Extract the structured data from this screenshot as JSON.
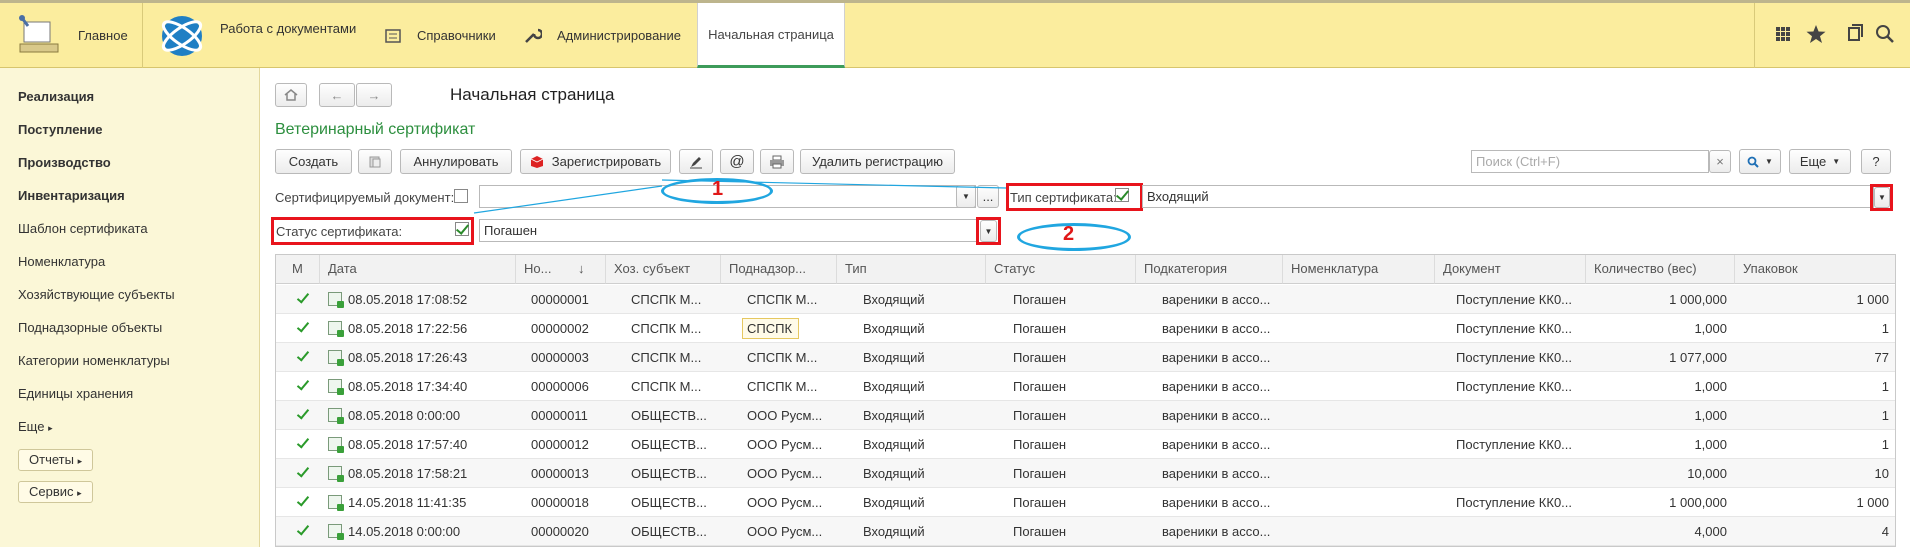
{
  "topbar": {
    "home": "Главное",
    "docs": "Работа с документами",
    "refs": "Справочники",
    "admin": "Администрирование",
    "start": "Начальная страница"
  },
  "sidebar": {
    "items": [
      "Реализация",
      "Поступление",
      "Производство",
      "Инвентаризация",
      "Шаблон сертификата",
      "Номенклатура",
      "Хозяйствующие субъекты",
      "Поднадзорные объекты",
      "Категории номенклатуры",
      "Единицы хранения",
      "Еще"
    ],
    "reports": "Отчеты",
    "service": "Сервис"
  },
  "main": {
    "page_title": "Начальная страница",
    "form_title": "Ветеринарный сертификат",
    "toolbar": {
      "create": "Создать",
      "cancel": "Аннулировать",
      "register": "Зарегистрировать",
      "unregister": "Удалить регистрацию",
      "search_placeholder": "Поиск (Ctrl+F)",
      "more": "Еще",
      "help": "?"
    },
    "filters": {
      "cert_doc_label": "Сертифицируемый документ:",
      "cert_type_label": "Тип сертификата:",
      "cert_type_value": "Входящий",
      "status_label": "Статус сертификата:",
      "status_value": "Погашен"
    },
    "annotations": [
      "1",
      "2"
    ]
  },
  "table": {
    "columns": [
      "М",
      "Дата",
      "Но...",
      "Хоз. субъект",
      "Поднадзор...",
      "Тип",
      "Статус",
      "Подкатегория",
      "Номенклатура",
      "Документ",
      "Количество (вес)",
      "Упаковок"
    ],
    "rows": [
      {
        "date": "08.05.2018 17:08:52",
        "num": "00000001",
        "subject": "СПСПК  М...",
        "object": "СПСПК  М...",
        "type": "Входящий",
        "status": "Погашен",
        "subcat": "вареники в ассо...",
        "nomen": "",
        "doc": "Поступление КК0...",
        "qty": "1 000,000",
        "pack": "1 000"
      },
      {
        "date": "08.05.2018 17:22:56",
        "num": "00000002",
        "subject": "СПСПК  М...",
        "object": "СПСПК",
        "type": "Входящий",
        "status": "Погашен",
        "subcat": "вареники в ассо...",
        "nomen": "",
        "doc": "Поступление КК0...",
        "qty": "1,000",
        "pack": "1"
      },
      {
        "date": "08.05.2018 17:26:43",
        "num": "00000003",
        "subject": "СПСПК  М...",
        "object": "СПСПК  М...",
        "type": "Входящий",
        "status": "Погашен",
        "subcat": "вареники в ассо...",
        "nomen": "",
        "doc": "Поступление КК0...",
        "qty": "1 077,000",
        "pack": "77"
      },
      {
        "date": "08.05.2018 17:34:40",
        "num": "00000006",
        "subject": "СПСПК  М...",
        "object": "СПСПК  М...",
        "type": "Входящий",
        "status": "Погашен",
        "subcat": "вареники в ассо...",
        "nomen": "",
        "doc": "Поступление КК0...",
        "qty": "1,000",
        "pack": "1"
      },
      {
        "date": "08.05.2018 0:00:00",
        "num": "00000011",
        "subject": "ОБЩЕСТВ...",
        "object": "ООО Русм...",
        "type": "Входящий",
        "status": "Погашен",
        "subcat": "вареники в ассо...",
        "nomen": "",
        "doc": "",
        "qty": "1,000",
        "pack": "1"
      },
      {
        "date": "08.05.2018 17:57:40",
        "num": "00000012",
        "subject": "ОБЩЕСТВ...",
        "object": "ООО Русм...",
        "type": "Входящий",
        "status": "Погашен",
        "subcat": "вареники в ассо...",
        "nomen": "",
        "doc": "Поступление КК0...",
        "qty": "1,000",
        "pack": "1"
      },
      {
        "date": "08.05.2018 17:58:21",
        "num": "00000013",
        "subject": "ОБЩЕСТВ...",
        "object": "ООО Русм...",
        "type": "Входящий",
        "status": "Погашен",
        "subcat": "вареники в ассо...",
        "nomen": "",
        "doc": "",
        "qty": "10,000",
        "pack": "10"
      },
      {
        "date": "14.05.2018 11:41:35",
        "num": "00000018",
        "subject": "ОБЩЕСТВ...",
        "object": "ООО Русм...",
        "type": "Входящий",
        "status": "Погашен",
        "subcat": "вареники в ассо...",
        "nomen": "",
        "doc": "Поступление КК0...",
        "qty": "1 000,000",
        "pack": "1 000"
      },
      {
        "date": "14.05.2018 0:00:00",
        "num": "00000020",
        "subject": "ОБЩЕСТВ...",
        "object": "ООО Русм...",
        "type": "Входящий",
        "status": "Погашен",
        "subcat": "вареники в ассо...",
        "nomen": "",
        "doc": "",
        "qty": "4,000",
        "pack": "4"
      }
    ]
  }
}
